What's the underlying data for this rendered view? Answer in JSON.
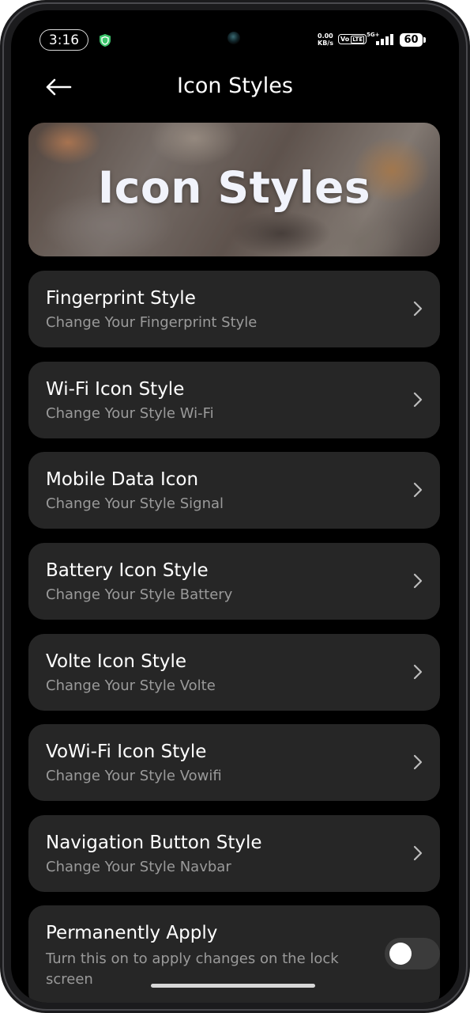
{
  "status_bar": {
    "time": "3:16",
    "net_speed_value": "0.00",
    "net_speed_unit": "KB/s",
    "volte_label": "Vo",
    "lte_label": "LTE",
    "network_type": "5G+",
    "battery_level": "60",
    "icons": [
      "shield-icon",
      "signal-icon",
      "battery-icon"
    ]
  },
  "header": {
    "title": "Icon Styles",
    "back_icon": "arrow-left-icon"
  },
  "banner": {
    "title": "Icon Styles"
  },
  "menu_items": [
    {
      "title": "Fingerprint Style",
      "subtitle": "Change Your Fingerprint Style"
    },
    {
      "title": "Wi-Fi Icon Style",
      "subtitle": "Change Your Style Wi-Fi"
    },
    {
      "title": "Mobile Data Icon",
      "subtitle": "Change Your Style Signal"
    },
    {
      "title": "Battery Icon Style",
      "subtitle": "Change Your Style Battery"
    },
    {
      "title": "Volte Icon Style",
      "subtitle": "Change Your Style Volte"
    },
    {
      "title": "VoWi-Fi Icon Style",
      "subtitle": "Change Your Style Vowifi"
    },
    {
      "title": "Navigation Button Style",
      "subtitle": "Change Your Style Navbar"
    }
  ],
  "permanent_apply": {
    "title": "Permanently Apply",
    "subtitle": "Turn this on to apply changes on the lock screen",
    "enabled": false
  },
  "colors": {
    "background": "#000000",
    "card": "#262626",
    "title_text": "#ffffff",
    "subtitle_text": "#9a9a9a",
    "banner_text": "#f1f3fb",
    "shield_icon": "#3cc46b"
  }
}
